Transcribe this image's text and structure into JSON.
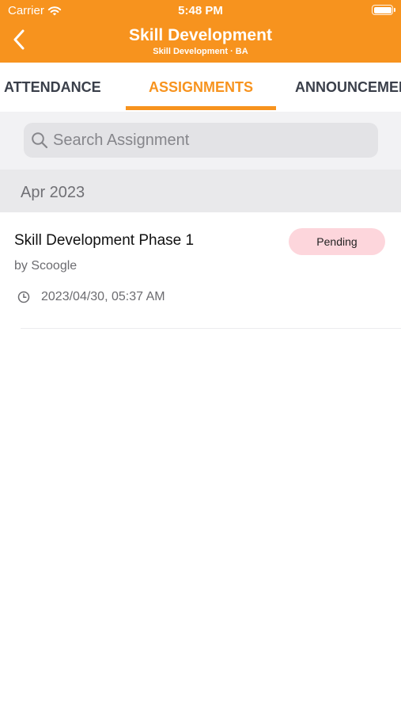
{
  "status_bar": {
    "carrier": "Carrier",
    "time": "5:48 PM"
  },
  "nav": {
    "title": "Skill Development",
    "subtitle": "Skill Development · BA",
    "back_icon": "chevron-left-icon"
  },
  "tabs": [
    {
      "label": "ATTENDANCE",
      "active": false
    },
    {
      "label": "ASSIGNMENTS",
      "active": true
    },
    {
      "label": "ANNOUNCEMENTS",
      "active": false
    }
  ],
  "search": {
    "placeholder": "Search Assignment",
    "value": ""
  },
  "section": {
    "title": "Apr 2023"
  },
  "assignments": [
    {
      "title": "Skill Development Phase 1",
      "author": "by Scoogle",
      "datetime": "2023/04/30, 05:37 AM",
      "status": "Pending"
    }
  ],
  "colors": {
    "accent": "#f7931e",
    "pending_badge": "#fdd6dc",
    "section_bg": "#e9e9eb"
  }
}
